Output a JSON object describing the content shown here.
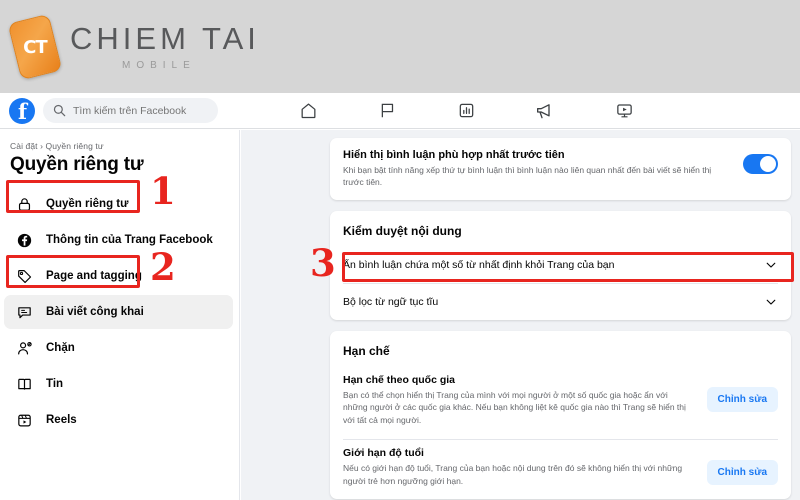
{
  "branding": {
    "logo_badge": "CT",
    "name": "CHIEM TAI",
    "tagline": "MOBILE"
  },
  "fb_header": {
    "logo_icon": "facebook-logo-icon",
    "search_placeholder": "Tìm kiếm trên Facebook",
    "search_value": "",
    "search_icon": "search-icon",
    "nav": [
      {
        "name": "home-icon",
        "label": "Trang chủ"
      },
      {
        "name": "flag-icon",
        "label": "Trang"
      },
      {
        "name": "insights-chart-icon",
        "label": "Thông tin chi tiết"
      },
      {
        "name": "megaphone-icon",
        "label": "Quảng cáo"
      },
      {
        "name": "video-play-icon",
        "label": "Video"
      }
    ]
  },
  "sidebar": {
    "breadcrumb": "Cài đặt › Quyền riêng tư",
    "title": "Quyền riêng tư",
    "items": [
      {
        "label": "Quyền riêng tư",
        "icon": "lock-icon",
        "selected": false
      },
      {
        "label": "Thông tin của Trang Facebook",
        "icon": "facebook-circle-icon",
        "selected": false
      },
      {
        "label": "Page and tagging",
        "icon": "tag-icon",
        "selected": false
      },
      {
        "label": "Bài viết công khai",
        "icon": "comment-bubble-icon",
        "selected": true
      },
      {
        "label": "Chặn",
        "icon": "person-block-icon",
        "selected": false
      },
      {
        "label": "Tin",
        "icon": "book-icon",
        "selected": false
      },
      {
        "label": "Reels",
        "icon": "reels-icon",
        "selected": false
      }
    ]
  },
  "main": {
    "comment_order": {
      "title": "Hiển thị bình luận phù hợp nhất trước tiên",
      "description": "Khi bạn bật tính năng xếp thứ tự bình luận thì bình luận nào liên quan nhất đến bài viết sẽ hiển thị trước tiên.",
      "toggle_state": "on"
    },
    "moderation": {
      "section_title": "Kiểm duyệt nội dung",
      "rows": [
        {
          "label": "Ẩn bình luận chứa một số từ nhất định khỏi Trang của bạn",
          "chevron": "chevron-down-icon"
        },
        {
          "label": "Bộ lọc từ ngữ tục tĩu",
          "chevron": "chevron-down-icon"
        }
      ]
    },
    "restrictions": {
      "section_title": "Hạn chế",
      "rows": [
        {
          "title": "Hạn chế theo quốc gia",
          "description": "Bạn có thể chọn hiển thị Trang của mình với mọi người ở một số quốc gia hoặc ẩn với những người ở các quốc gia khác. Nếu bạn không liệt kê quốc gia nào thì Trang sẽ hiển thị với tất cả mọi người.",
          "button": "Chỉnh sửa"
        },
        {
          "title": "Giới hạn độ tuổi",
          "description": "Nếu có giới hạn độ tuổi, Trang của bạn hoặc nội dung trên đó sẽ không hiển thị với những người trẻ hơn ngưỡng giới hạn.",
          "button": "Chỉnh sửa"
        }
      ]
    }
  },
  "annotations": {
    "markers": [
      {
        "number": "1"
      },
      {
        "number": "2"
      },
      {
        "number": "3"
      }
    ],
    "color": "#e8251f"
  }
}
